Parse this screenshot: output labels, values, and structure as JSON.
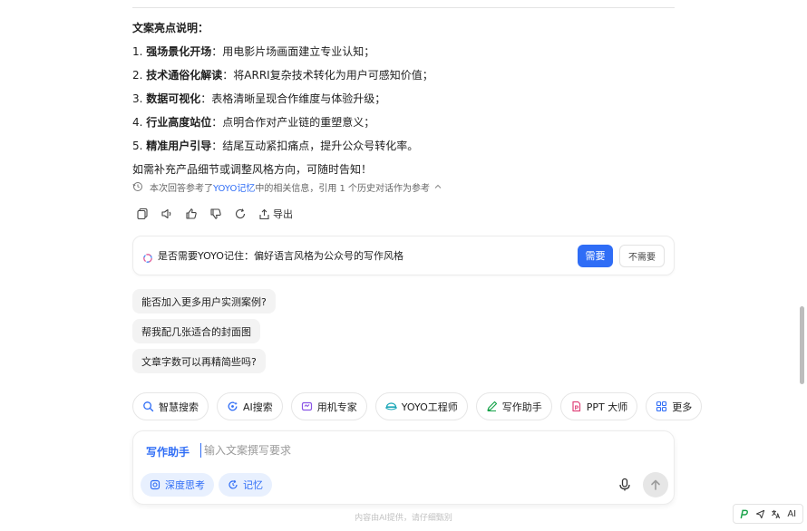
{
  "content": {
    "heading": "文案亮点说明：",
    "items": [
      {
        "num": "1.",
        "bold": "强场景化开场",
        "text": "：用电影片场画面建立专业认知；"
      },
      {
        "num": "2.",
        "bold": "技术通俗化解读",
        "text": "：将ARRI复杂技术转化为用户可感知价值；"
      },
      {
        "num": "3.",
        "bold": "数据可视化",
        "text": "：表格清晰呈现合作维度与体验升级；"
      },
      {
        "num": "4.",
        "bold": "行业高度站位",
        "text": "：点明合作对产业链的重塑意义；"
      },
      {
        "num": "5.",
        "bold": "精准用户引导",
        "text": "：结尾互动紧扣痛点，提升公众号转化率。"
      }
    ],
    "closing": "如需补充产品细节或调整风格方向，可随时告知！"
  },
  "reference": {
    "prefix": "本次回答参考了",
    "highlight": "YOYO记忆",
    "suffix": "中的相关信息，引用 1 个历史对话作为参考"
  },
  "actions": {
    "export_label": "导出"
  },
  "memory_prompt": {
    "text": "是否需要YOYO记住：偏好语言风格为公众号的写作风格",
    "yes_label": "需要",
    "no_label": "不需要"
  },
  "suggestions": [
    "能否加入更多用户实测案例?",
    "帮我配几张适合的封面图",
    "文章字数可以再精简些吗?"
  ],
  "tools": [
    {
      "label": "智慧搜索",
      "icon": "search-icon"
    },
    {
      "label": "AI搜索",
      "icon": "ai-search-icon"
    },
    {
      "label": "用机专家",
      "icon": "phone-expert-icon"
    },
    {
      "label": "YOYO工程师",
      "icon": "engineer-icon"
    },
    {
      "label": "写作助手",
      "icon": "pen-icon"
    },
    {
      "label": "PPT 大师",
      "icon": "ppt-icon"
    },
    {
      "label": "更多",
      "icon": "grid-icon"
    }
  ],
  "composer": {
    "mode_label": "写作助手",
    "placeholder": "输入文案撰写要求",
    "deep_think_label": "深度思考",
    "memory_label": "记忆"
  },
  "footnote": "内容由AI提供，请仔细甄别",
  "extension_bar": {
    "label": "AI"
  },
  "colors": {
    "accent": "#2f6df6",
    "chip_bg": "#e8f0fe",
    "suggestion_bg": "#f3f3f3"
  }
}
